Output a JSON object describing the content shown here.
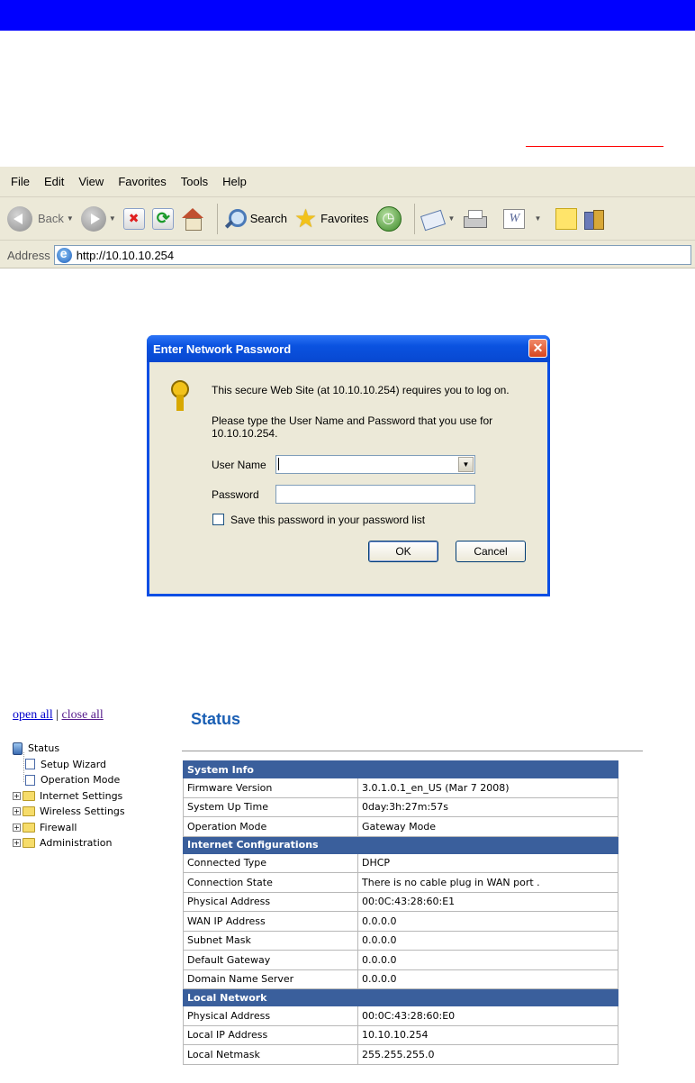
{
  "ie": {
    "menu": [
      "File",
      "Edit",
      "View",
      "Favorites",
      "Tools",
      "Help"
    ],
    "toolbar": {
      "back_label": "Back",
      "search_label": "Search",
      "favorites_label": "Favorites"
    },
    "address": {
      "label": "Address",
      "url": "http://10.10.10.254"
    }
  },
  "dialog": {
    "title": "Enter Network Password",
    "message": "This secure Web Site (at 10.10.10.254) requires you to log on.",
    "prompt": "Please type the User Name and Password that you use for 10.10.10.254.",
    "username_label": "User Name",
    "password_label": "Password",
    "save_label": "Save this password in your password list",
    "ok_label": "OK",
    "cancel_label": "Cancel"
  },
  "router": {
    "open_all": "open all",
    "separator": "|",
    "close_all": "close all",
    "tree": {
      "root": "Status",
      "children": [
        "Setup Wizard",
        "Operation Mode"
      ],
      "folders": [
        "Internet Settings",
        "Wireless Settings",
        "Firewall",
        "Administration"
      ]
    },
    "title": "Status",
    "sections": [
      {
        "heading": "System Info",
        "rows": [
          {
            "key": "Firmware Version",
            "value": "3.0.1.0.1_en_US (Mar 7 2008)"
          },
          {
            "key": "System Up Time",
            "value": "0day:3h:27m:57s"
          },
          {
            "key": "Operation Mode",
            "value": "Gateway Mode"
          }
        ]
      },
      {
        "heading": "Internet Configurations",
        "rows": [
          {
            "key": "Connected Type",
            "value": "DHCP"
          },
          {
            "key": "Connection State",
            "value": "There is no cable plug in WAN port ."
          },
          {
            "key": "Physical Address",
            "value": "00:0C:43:28:60:E1"
          },
          {
            "key": "WAN IP Address",
            "value": "0.0.0.0"
          },
          {
            "key": "Subnet Mask",
            "value": "0.0.0.0"
          },
          {
            "key": "Default Gateway",
            "value": "0.0.0.0"
          },
          {
            "key": "Domain Name Server",
            "value": "0.0.0.0"
          }
        ]
      },
      {
        "heading": "Local Network",
        "rows": [
          {
            "key": "Physical Address",
            "value": "00:0C:43:28:60:E0"
          },
          {
            "key": "Local IP Address",
            "value": "10.10.10.254"
          },
          {
            "key": "Local Netmask",
            "value": "255.255.255.0"
          }
        ]
      }
    ]
  }
}
